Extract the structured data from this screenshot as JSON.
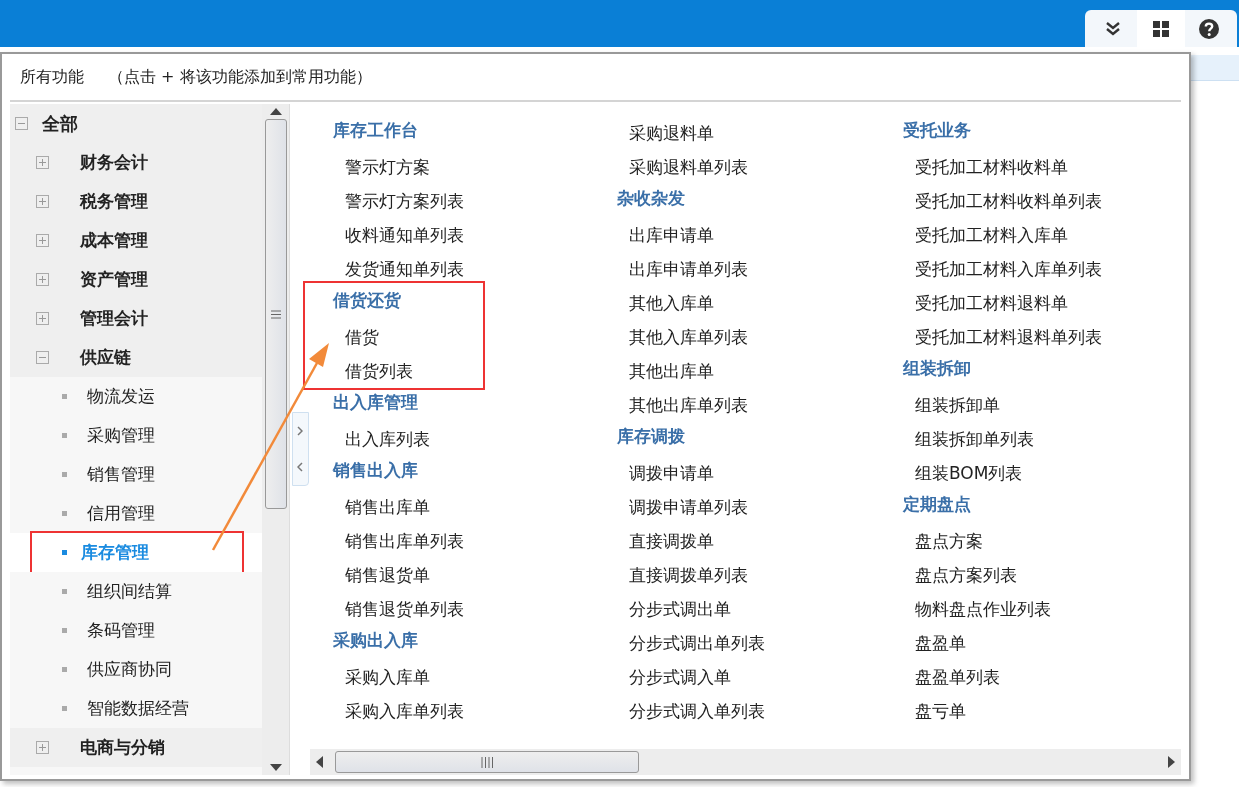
{
  "toolbar": {
    "buttons": [
      {
        "kind": "collapse"
      },
      {
        "kind": "grid"
      },
      {
        "kind": "help"
      }
    ]
  },
  "panel": {
    "title": "所有功能",
    "hint": "（点击 + 将该功能添加到常用功能）"
  },
  "tree": {
    "label": "全部",
    "expanded": true,
    "children": [
      {
        "label": "财务会计",
        "expanded": false
      },
      {
        "label": "税务管理",
        "expanded": false
      },
      {
        "label": "成本管理",
        "expanded": false
      },
      {
        "label": "资产管理",
        "expanded": false
      },
      {
        "label": "管理会计",
        "expanded": false
      },
      {
        "label": "供应链",
        "expanded": true,
        "children": [
          {
            "label": "物流发运",
            "selected": false
          },
          {
            "label": "采购管理",
            "selected": false
          },
          {
            "label": "销售管理",
            "selected": false
          },
          {
            "label": "信用管理",
            "selected": false
          },
          {
            "label": "库存管理",
            "selected": true,
            "highlighted": true
          },
          {
            "label": "组织间结算",
            "selected": false
          },
          {
            "label": "条码管理",
            "selected": false
          },
          {
            "label": "供应商协同",
            "selected": false
          },
          {
            "label": "智能数据经营",
            "selected": false
          }
        ]
      },
      {
        "label": "电商与分销",
        "expanded": false
      }
    ]
  },
  "columns": [
    [
      {
        "heading": "库存工作台",
        "items": [
          "警示灯方案",
          "警示灯方案列表",
          "收料通知单列表",
          "发货通知单列表"
        ]
      },
      {
        "heading": "借货还货",
        "highlighted": true,
        "items": [
          "借货",
          "借货列表"
        ]
      },
      {
        "heading": "出入库管理",
        "items": [
          "出入库列表"
        ]
      },
      {
        "heading": "销售出入库",
        "items": [
          "销售出库单",
          "销售出库单列表",
          "销售退货单",
          "销售退货单列表"
        ]
      },
      {
        "heading": "采购出入库",
        "items": [
          "采购入库单",
          "采购入库单列表"
        ]
      }
    ],
    [
      {
        "items": [
          "采购退料单",
          "采购退料单列表"
        ]
      },
      {
        "heading": "杂收杂发",
        "items": [
          "出库申请单",
          "出库申请单列表",
          "其他入库单",
          "其他入库单列表",
          "其他出库单",
          "其他出库单列表"
        ]
      },
      {
        "heading": "库存调拨",
        "items": [
          "调拨申请单",
          "调拨申请单列表",
          "直接调拨单",
          "直接调拨单列表",
          "分步式调出单",
          "分步式调出单列表",
          "分步式调入单",
          "分步式调入单列表"
        ]
      }
    ],
    [
      {
        "heading": "受托业务",
        "items": [
          "受托加工材料收料单",
          "受托加工材料收料单列表",
          "受托加工材料入库单",
          "受托加工材料入库单列表",
          "受托加工材料退料单",
          "受托加工材料退料单列表"
        ]
      },
      {
        "heading": "组装拆卸",
        "items": [
          "组装拆卸单",
          "组装拆卸单列表",
          "组装BOM列表"
        ]
      },
      {
        "heading": "定期盘点",
        "items": [
          "盘点方案",
          "盘点方案列表",
          "物料盘点作业列表",
          "盘盈单",
          "盘盈单列表",
          "盘亏单"
        ]
      }
    ]
  ],
  "callout_arrow": true
}
